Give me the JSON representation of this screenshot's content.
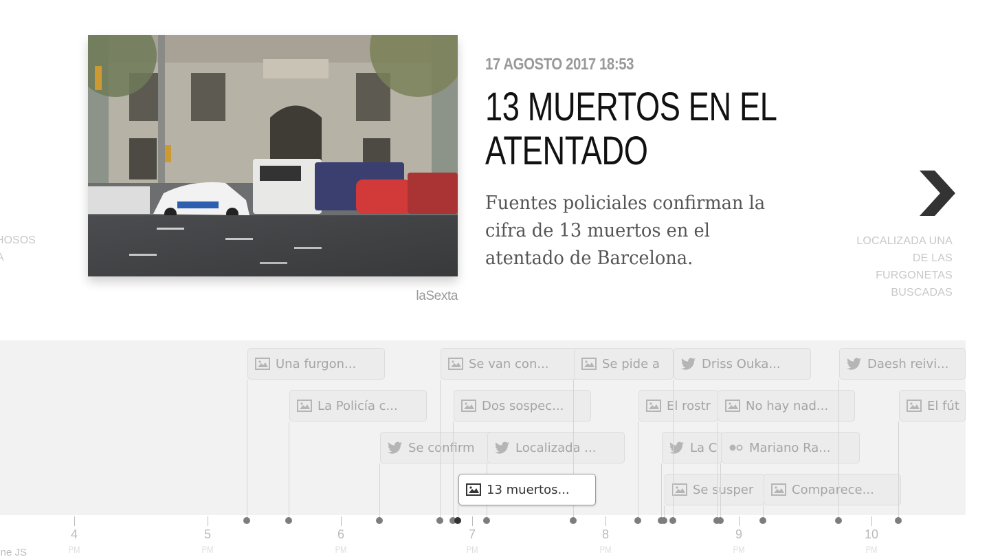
{
  "slide": {
    "date": "17 AGOSTO 2017 18:53",
    "headline": "13 MUERTOS EN EL ATENTADO",
    "text": "Fuentes policiales confirman la cifra de 13 muertos en el atentado de Barcelona.",
    "credit": "laSexta",
    "prev_label": "OSPECHOSOS SQUEDA",
    "next_label": "LOCALIZADA UNA DE LAS FURGONETAS BUSCADAS",
    "next_icon": "chevron-right-icon"
  },
  "timeline": {
    "brand": "line JS",
    "ticks": [
      {
        "hour": "4",
        "suffix": "PM"
      },
      {
        "hour": "5",
        "suffix": "PM"
      },
      {
        "hour": "6",
        "suffix": "PM"
      },
      {
        "hour": "7",
        "suffix": "PM"
      },
      {
        "hour": "8",
        "suffix": "PM"
      },
      {
        "hour": "9",
        "suffix": "PM"
      },
      {
        "hour": "10",
        "suffix": "PM"
      }
    ],
    "markers": [
      {
        "label": "Una furgon...",
        "icon": "image-icon"
      },
      {
        "label": "La Policía c...",
        "icon": "image-icon"
      },
      {
        "label": "Se confirm",
        "icon": "twitter-icon"
      },
      {
        "label": "Se van con...",
        "icon": "image-icon"
      },
      {
        "label": "Dos sospec...",
        "icon": "image-icon"
      },
      {
        "label": "Localizada ...",
        "icon": "twitter-icon"
      },
      {
        "label": "13 muertos...",
        "icon": "image-icon",
        "active": true
      },
      {
        "label": "Se pide a",
        "icon": "image-icon"
      },
      {
        "label": "El rostr",
        "icon": "image-icon"
      },
      {
        "label": "La C",
        "icon": "twitter-icon"
      },
      {
        "label": "Se susper",
        "icon": "image-icon"
      },
      {
        "label": "Driss Ouka...",
        "icon": "twitter-icon"
      },
      {
        "label": "No hay nad...",
        "icon": "image-icon"
      },
      {
        "label": "Mariano Ra...",
        "icon": "flickr-icon"
      },
      {
        "label": "Comparece...",
        "icon": "image-icon"
      },
      {
        "label": "Daesh reivi...",
        "icon": "twitter-icon"
      },
      {
        "label": "El fút",
        "icon": "image-icon"
      }
    ]
  },
  "colors": {
    "timeline_bg": "#f2f2f2",
    "marker_bg": "#ececec",
    "dot": "#7d7d7d",
    "headline": "#111111",
    "muted": "#999999"
  }
}
